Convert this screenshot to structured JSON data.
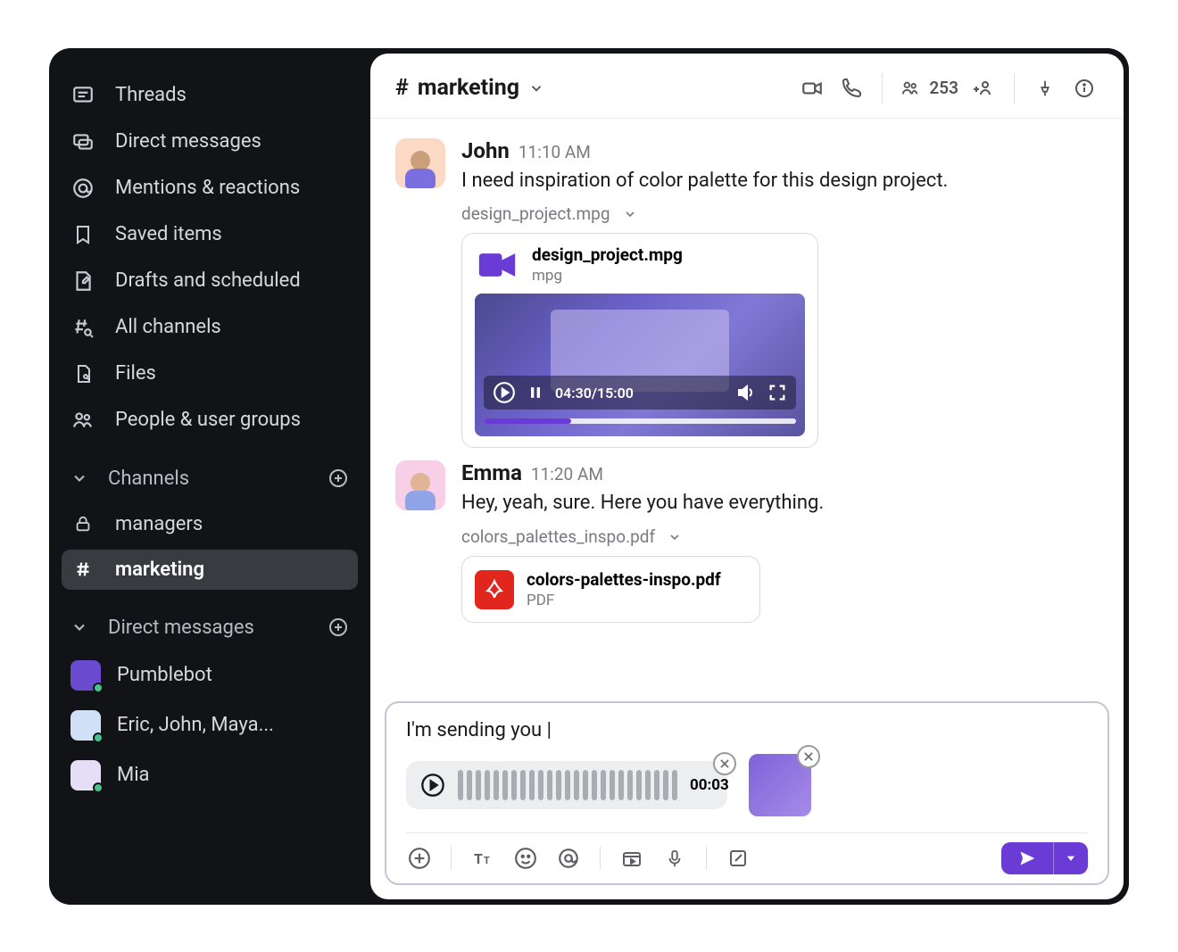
{
  "sidebar": {
    "nav": [
      {
        "label": "Threads"
      },
      {
        "label": "Direct messages"
      },
      {
        "label": "Mentions & reactions"
      },
      {
        "label": "Saved items"
      },
      {
        "label": "Drafts and scheduled"
      },
      {
        "label": "All channels"
      },
      {
        "label": "Files"
      },
      {
        "label": "People & user groups"
      }
    ],
    "channels_header": "Channels",
    "channels": [
      {
        "label": "managers",
        "locked": true
      },
      {
        "label": "marketing",
        "locked": false,
        "selected": true
      }
    ],
    "dm_header": "Direct messages",
    "dms": [
      {
        "label": "Pumblebot"
      },
      {
        "label": "Eric, John, Maya..."
      },
      {
        "label": "Mia"
      }
    ]
  },
  "header": {
    "channel_prefix": "#",
    "channel_name": "marketing",
    "member_count": "253"
  },
  "messages": [
    {
      "author": "John",
      "time": "11:10 AM",
      "text": "I need inspiration of color palette for this design project.",
      "attachment_label": "design_project.mpg",
      "file_name": "design_project.mpg",
      "file_ext": "mpg",
      "video_time": "04:30/15:00"
    },
    {
      "author": "Emma",
      "time": "11:20 AM",
      "text": "Hey, yeah, sure. Here you have everything.",
      "attachment_label": "colors_palettes_inspo.pdf",
      "file_name": "colors-palettes-inspo.pdf",
      "file_ext": "PDF"
    }
  ],
  "composer": {
    "text": "I'm sending you |",
    "audio_duration": "00:03"
  }
}
